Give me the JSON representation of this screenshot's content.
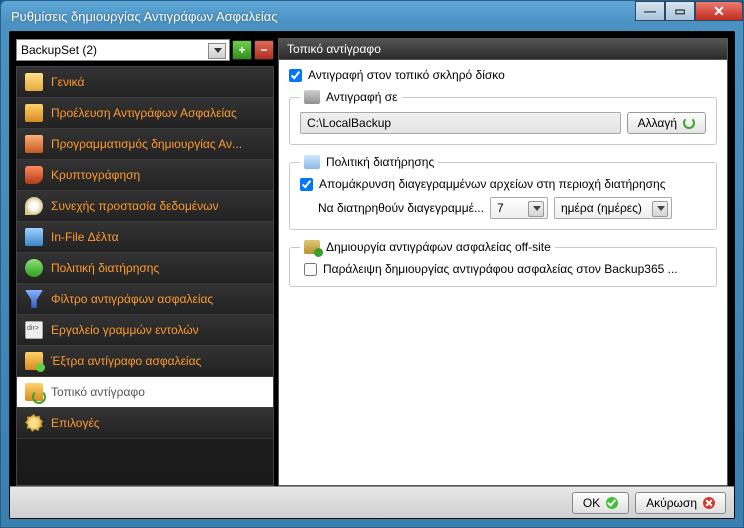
{
  "window": {
    "title": "Ρυθμίσεις δημιουργίας Αντιγράφων Ασφαλείας"
  },
  "backupset": {
    "selected": "BackupSet (2)"
  },
  "sidebar": {
    "items": [
      {
        "label": "Γενικά"
      },
      {
        "label": "Προέλευση Αντιγράφων Ασφαλείας"
      },
      {
        "label": "Προγραμματισμός δημιουργίας Αν..."
      },
      {
        "label": "Κρυπτογράφηση"
      },
      {
        "label": "Συνεχής προστασία δεδομένων"
      },
      {
        "label": "In-File Δέλτα"
      },
      {
        "label": "Πολιτική διατήρησης"
      },
      {
        "label": "Φίλτρο αντιγράφων ασφαλείας"
      },
      {
        "label": "Εργαλείο γραμμών εντολών"
      },
      {
        "label": "Έξτρα αντίγραφο ασφαλείας"
      },
      {
        "label": "Τοπικό αντίγραφο"
      },
      {
        "label": "Επιλογές"
      }
    ]
  },
  "main": {
    "header": "Τοπικό αντίγραφο",
    "enable_label": "Αντιγραφή στον τοπικό σκληρό δίσκο",
    "copyto": {
      "legend": "Αντιγραφή σε",
      "path": "C:\\LocalBackup",
      "change_btn": "Αλλαγή"
    },
    "retention": {
      "legend": "Πολιτική διατήρησης",
      "remove_label": "Απομάκρυνση διαγεγραμμένων αρχείων στη περιοχή διατήρησης",
      "keep_label": "Να διατηρηθούν διαγεγραμμέ...",
      "value": "7",
      "unit": "ημέρα (ημέρες)"
    },
    "offsite": {
      "legend": "Δημιουργία αντιγράφων ασφαλείας off-site",
      "skip_label": "Παράλειψη δημιουργίας αντιγράφου ασφαλείας στον Backup365 ..."
    }
  },
  "footer": {
    "ok": "OK",
    "cancel": "Ακύρωση"
  }
}
